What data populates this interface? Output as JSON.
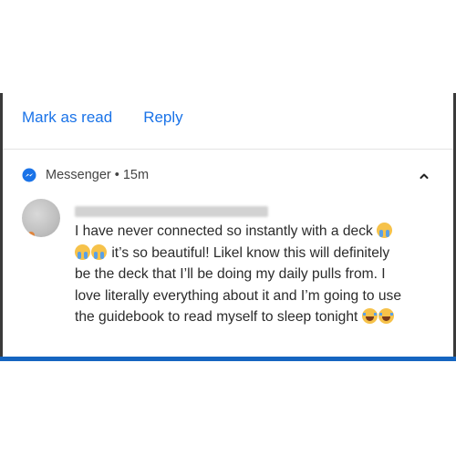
{
  "actions": {
    "mark_as_read": "Mark as read",
    "reply": "Reply"
  },
  "notification": {
    "app_name": "Messenger",
    "separator": "•",
    "time": "15m",
    "app_icon": "messenger-icon",
    "expand_icon": "chevron-up-icon",
    "message_lines": [
      "I have never connected so instantly with a deck",
      "it’s so beautiful! Likel know this will definitely",
      "be the deck that I’ll be doing my daily pulls from.  I",
      "love literally everything about it and I’m going to use",
      "the guidebook to read myself to sleep tonight"
    ]
  },
  "colors": {
    "accent": "#1a73e8",
    "bottom_bar": "#1565c0",
    "frame": "#3a3a3a"
  }
}
